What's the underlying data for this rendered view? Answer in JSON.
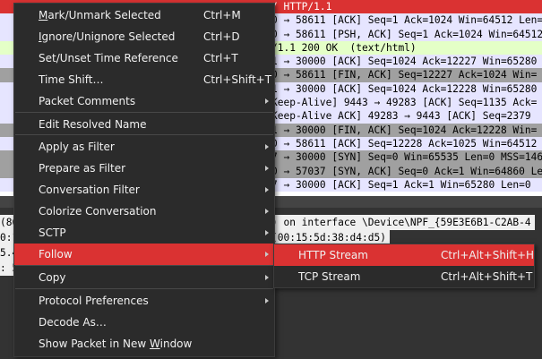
{
  "colors": {
    "menu_bg": "#2b2b2b",
    "menu_text": "#f0f0f0",
    "highlight": "#da3232",
    "row_purple": "#e6e5ff",
    "row_gray": "#a0a0a0",
    "row_green": "#e4ffc7",
    "details_bg": "#333333"
  },
  "packet_rows": [
    {
      "text": "/ HTTP/1.1",
      "bg": "#da3232",
      "fg": "#ffffff"
    },
    {
      "text": "0 → 58611 [ACK] Seq=1 Ack=1024 Win=64512 Len=",
      "bg": "#e6e5ff",
      "fg": "#000000"
    },
    {
      "text": "0 → 58611 [PSH, ACK] Seq=1 Ack=1024 Win=64512",
      "bg": "#e6e5ff",
      "fg": "#000000"
    },
    {
      "text": "/1.1 200 OK  (text/html)",
      "bg": "#e4ffc7",
      "fg": "#000000"
    },
    {
      "text": "1 → 30000 [ACK] Seq=1024 Ack=12227 Win=65280",
      "bg": "#e6e5ff",
      "fg": "#000000"
    },
    {
      "text": "0 → 58611 [FIN, ACK] Seq=12227 Ack=1024 Win=",
      "bg": "#a0a0a0",
      "fg": "#000000"
    },
    {
      "text": "1 → 30000 [ACK] Seq=1024 Ack=12228 Win=65280",
      "bg": "#e6e5ff",
      "fg": "#000000"
    },
    {
      "text": "Keep-Alive] 9443 → 49283 [ACK] Seq=1135 Ack=",
      "bg": "#e6e5ff",
      "fg": "#000000"
    },
    {
      "text": "Keep-Alive ACK] 49283 → 9443 [ACK] Seq=2379",
      "bg": "#e6e5ff",
      "fg": "#000000"
    },
    {
      "text": "1 → 30000 [FIN, ACK] Seq=1024 Ack=12228 Win=",
      "bg": "#a0a0a0",
      "fg": "#000000"
    },
    {
      "text": "0 → 58611 [ACK] Seq=12228 Ack=1025 Win=64512",
      "bg": "#e6e5ff",
      "fg": "#000000"
    },
    {
      "text": "7 → 30000 [SYN] Seq=0 Win=65535 Len=0 MSS=146",
      "bg": "#a0a0a0",
      "fg": "#000000"
    },
    {
      "text": "0 → 57037 [SYN, ACK] Seq=0 Ack=1 Win=64860 Le",
      "bg": "#a0a0a0",
      "fg": "#000000"
    },
    {
      "text": "7 → 30000 [ACK] Seq=1 Ack=1 Win=65280 Len=0",
      "bg": "#e6e5ff",
      "fg": "#000000"
    }
  ],
  "detail_rows": [
    {
      "left": "(86",
      "text": ") on interface \\Device\\NPF_{59E3E6B1-C2AB-4",
      "bg": "#f0f0f0"
    },
    {
      "left": "0:1",
      "text": "(00:15:5d:38:d4:d5)",
      "bg": "#f0f0f0"
    },
    {
      "left": "5.4",
      "text": "",
      "bg": "#f0f0f0"
    },
    {
      "left": ": 5",
      "text": "",
      "bg": "#f0f0f0"
    }
  ],
  "main_menu": {
    "items": [
      {
        "label_pre": "",
        "label_ul": "M",
        "label_post": "ark/Unmark Selected",
        "shortcut": "Ctrl+M",
        "submenu": false
      },
      {
        "label_pre": "",
        "label_ul": "I",
        "label_post": "gnore/Unignore Selected",
        "shortcut": "Ctrl+D",
        "submenu": false
      },
      {
        "label_pre": "Set/Unset Time Reference",
        "label_ul": "",
        "label_post": "",
        "shortcut": "Ctrl+T",
        "submenu": false
      },
      {
        "label_pre": "Time Shift…",
        "label_ul": "",
        "label_post": "",
        "shortcut": "Ctrl+Shift+T",
        "submenu": false
      },
      {
        "label_pre": "Packet Comments",
        "label_ul": "",
        "label_post": "",
        "shortcut": "",
        "submenu": true
      },
      {
        "label_pre": "Edit Resolved Name",
        "label_ul": "",
        "label_post": "",
        "shortcut": "",
        "submenu": false
      },
      {
        "label_pre": "Apply as Filter",
        "label_ul": "",
        "label_post": "",
        "shortcut": "",
        "submenu": true
      },
      {
        "label_pre": "Prepare as Filter",
        "label_ul": "",
        "label_post": "",
        "shortcut": "",
        "submenu": true
      },
      {
        "label_pre": "Conversation Filter",
        "label_ul": "",
        "label_post": "",
        "shortcut": "",
        "submenu": true
      },
      {
        "label_pre": "Colorize Conversation",
        "label_ul": "",
        "label_post": "",
        "shortcut": "",
        "submenu": true
      },
      {
        "label_pre": "SCTP",
        "label_ul": "",
        "label_post": "",
        "shortcut": "",
        "submenu": true
      },
      {
        "label_pre": "Follow",
        "label_ul": "",
        "label_post": "",
        "shortcut": "",
        "submenu": true,
        "active": true
      },
      {
        "label_pre": "Copy",
        "label_ul": "",
        "label_post": "",
        "shortcut": "",
        "submenu": true
      },
      {
        "label_pre": "Protocol Preferences",
        "label_ul": "",
        "label_post": "",
        "shortcut": "",
        "submenu": true
      },
      {
        "label_pre": "Decode As…",
        "label_ul": "",
        "label_post": "",
        "shortcut": "",
        "submenu": false
      },
      {
        "label_pre": "Show Packet in New ",
        "label_ul": "W",
        "label_post": "indow",
        "shortcut": "",
        "submenu": false
      }
    ]
  },
  "sub_menu": {
    "items": [
      {
        "label": "HTTP Stream",
        "shortcut": "Ctrl+Alt+Shift+H",
        "active": true
      },
      {
        "label": "TCP Stream",
        "shortcut": "Ctrl+Alt+Shift+T",
        "active": false
      }
    ]
  }
}
